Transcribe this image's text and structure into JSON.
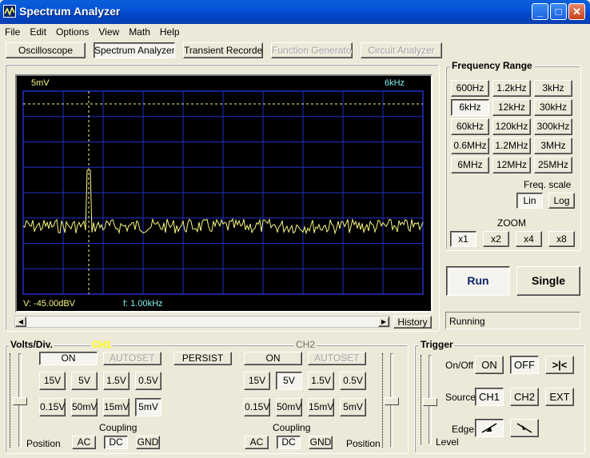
{
  "window": {
    "title": "Spectrum Analyzer",
    "minimize": "_",
    "maximize": "□",
    "close": "✕"
  },
  "menu": [
    "File",
    "Edit",
    "Options",
    "View",
    "Math",
    "Help"
  ],
  "instruments": [
    {
      "label": "Oscilloscope",
      "state": "normal"
    },
    {
      "label": "Spectrum Analyzer",
      "state": "active"
    },
    {
      "label": "Transient Recorder",
      "state": "normal"
    },
    {
      "label": "Function Generator",
      "state": "disabled"
    },
    {
      "label": "Circuit Analyzer",
      "state": "disabled"
    }
  ],
  "display": {
    "volts_label": "5mV",
    "freq_label": "6kHz",
    "readout_level": "V: -45.00dBV",
    "readout_freq": "f: 1.00kHz",
    "history_button": "History",
    "trace_color": "#f8f880",
    "grid_color": "#2030c8",
    "label_color_yellow": "#f8f880",
    "label_color_cyan": "#80f0f0"
  },
  "frequency_range": {
    "title": "Frequency Range",
    "buttons": [
      "600Hz",
      "1.2kHz",
      "3kHz",
      "6kHz",
      "12kHz",
      "30kHz",
      "60kHz",
      "120kHz",
      "300kHz",
      "0.6MHz",
      "1.2MHz",
      "3MHz",
      "6MHz",
      "12MHz",
      "25MHz"
    ],
    "selected": "6kHz",
    "freq_scale_label": "Freq. scale",
    "scale_lin": "Lin",
    "scale_log": "Log",
    "scale_selected": "Lin",
    "zoom_label": "ZOOM",
    "zoom": [
      "x1",
      "x2",
      "x4",
      "x8"
    ],
    "zoom_selected": "x1"
  },
  "run": {
    "run_label": "Run",
    "single_label": "Single",
    "status": "Running"
  },
  "volts_div": {
    "title": "Volts/Div.",
    "ch1": {
      "name": "CH1",
      "on": "ON",
      "autoset": "AUTOSET",
      "persist": "PERSIST",
      "volts": [
        "15V",
        "5V",
        "1.5V",
        "0.5V",
        "0.15V",
        "50mV",
        "15mV",
        "5mV"
      ],
      "selected": "5mV",
      "coupling_label": "Coupling",
      "coupling": [
        "AC",
        "DC",
        "GND"
      ],
      "coupling_selected": "DC",
      "position_label": "Position"
    },
    "ch2": {
      "name": "CH2",
      "on": "ON",
      "autoset": "AUTOSET",
      "volts": [
        "15V",
        "5V",
        "1.5V",
        "0.5V",
        "0.15V",
        "50mV",
        "15mV",
        "5mV"
      ],
      "selected": "5V",
      "coupling_label": "Coupling",
      "coupling": [
        "AC",
        "DC",
        "GND"
      ],
      "coupling_selected": "DC",
      "position_label": "Position"
    }
  },
  "trigger": {
    "title": "Trigger",
    "onoff_label": "On/Off",
    "on": "ON",
    "off": "OFF",
    "toggle_symbol": ">|<",
    "source_label": "Source",
    "sources": [
      "CH1",
      "CH2",
      "EXT"
    ],
    "edge_label": "Edge",
    "level_label": "Level"
  }
}
